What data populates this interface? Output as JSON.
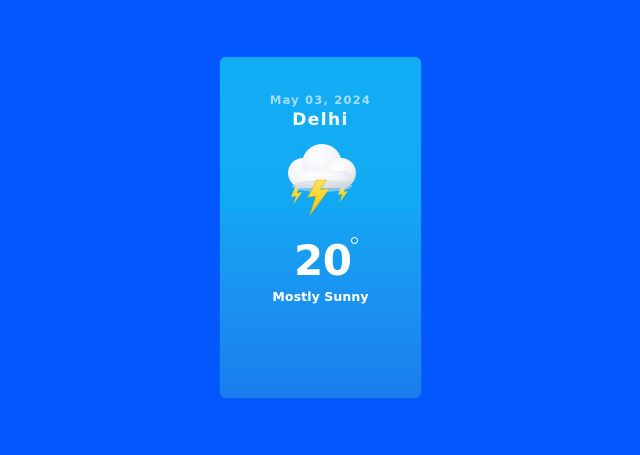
{
  "card": {
    "date": "May 03, 2024",
    "city": "Delhi",
    "icon": "thunderstorm-cloud-icon",
    "temperature": "20",
    "temperature_unit": "°",
    "condition": "Mostly Sunny"
  },
  "colors": {
    "background": "#0357FF",
    "card_top": "#12AEF5",
    "card_bottom": "#1A7DEE",
    "bolt": "#FFD60A"
  }
}
